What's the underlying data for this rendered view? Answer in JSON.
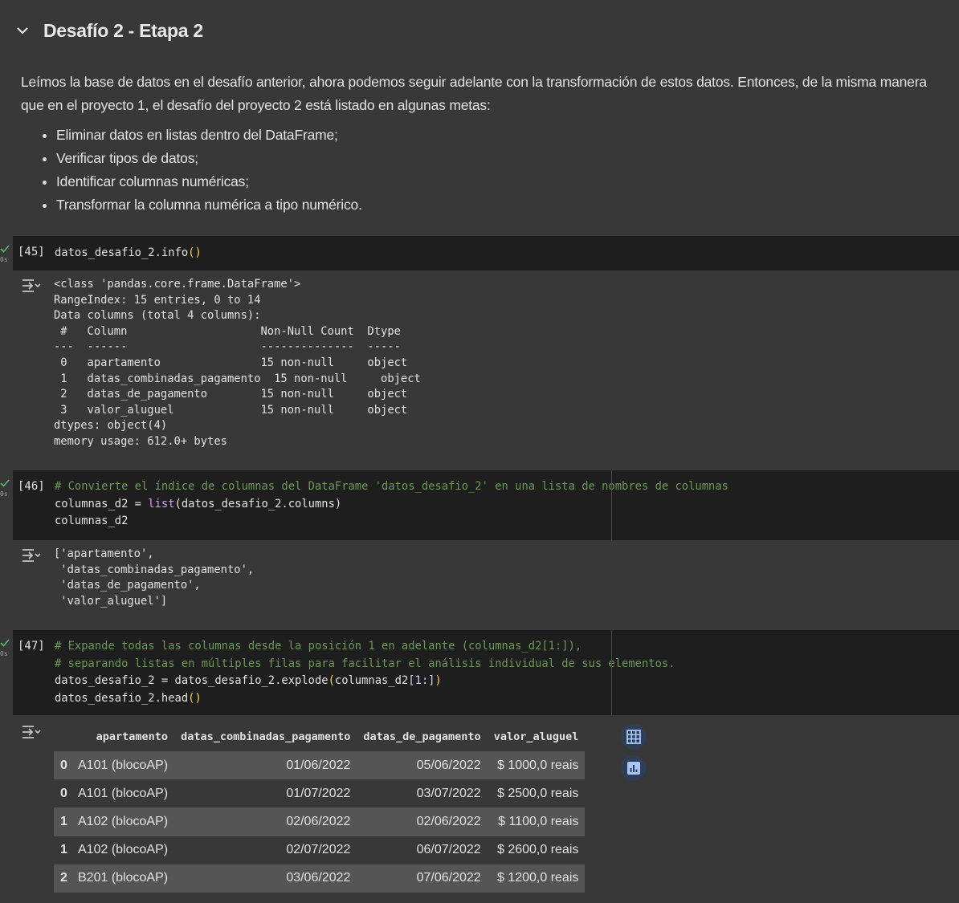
{
  "section": {
    "title": "Desafío 2 - Etapa 2",
    "intro": "Leímos la base de datos en el desafío anterior, ahora podemos seguir adelante con la transformación de estos datos. Entonces, de la misma manera que en el proyecto 1, el desafío del proyecto 2 está listado en algunas metas:",
    "goals": [
      "Eliminar datos en listas dentro del DataFrame;",
      "Verificar tipos de datos;",
      "Identificar columnas numéricas;",
      "Transformar la columna numérica a tipo numérico."
    ]
  },
  "cells": [
    {
      "count": "[45]",
      "exec_time": "0s",
      "code": {
        "l1_a": "datos_desafio_2.info",
        "l1_p": "()"
      },
      "output": [
        "<class 'pandas.core.frame.DataFrame'>",
        "RangeIndex: 15 entries, 0 to 14",
        "Data columns (total 4 columns):",
        " #   Column                    Non-Null Count  Dtype ",
        "---  ------                    --------------  ----- ",
        " 0   apartamento               15 non-null     object",
        " 1   datas_combinadas_pagamento  15 non-null     object",
        " 2   datas_de_pagamento        15 non-null     object",
        " 3   valor_aluguel             15 non-null     object",
        "dtypes: object(4)",
        "memory usage: 612.0+ bytes"
      ]
    },
    {
      "count": "[46]",
      "exec_time": "0s",
      "code": {
        "l1": "# Convierte el índice de columnas del DataFrame 'datos_desafio_2' en una lista de nombres de columnas",
        "l2_a": "columnas_d2 = ",
        "l2_b": "list",
        "l2_c": "(datos_desafio_2.columns)",
        "l3": "columnas_d2"
      },
      "output": [
        "['apartamento',",
        " 'datas_combinadas_pagamento',",
        " 'datas_de_pagamento',",
        " 'valor_aluguel']"
      ]
    },
    {
      "count": "[47]",
      "exec_time": "0s",
      "code": {
        "l1": "# Expande todas las columnas desde la posición 1 en adelante (columnas_d2[1:]),",
        "l2": "# separando listas en múltiples filas para facilitar el análisis individual de sus elementos.",
        "l3_a": "datos_desafio_2 = datos_desafio_2.explode",
        "l3_p1": "(",
        "l3_b": "columnas_d2",
        "l3_br": "[1:]",
        "l3_p2": ")",
        "l4_a": "datos_desafio_2.head",
        "l4_p": "()"
      }
    }
  ],
  "dataframe": {
    "columns": [
      "apartamento",
      "datas_combinadas_pagamento",
      "datas_de_pagamento",
      "valor_aluguel"
    ],
    "rows": [
      {
        "idx": "0",
        "apartamento": "A101 (blocoAP)",
        "combinadas": "01/06/2022",
        "pagamento": "05/06/2022",
        "valor": "$ 1000,0 reais"
      },
      {
        "idx": "0",
        "apartamento": "A101 (blocoAP)",
        "combinadas": "01/07/2022",
        "pagamento": "03/07/2022",
        "valor": "$ 2500,0 reais"
      },
      {
        "idx": "1",
        "apartamento": "A102 (blocoAP)",
        "combinadas": "02/06/2022",
        "pagamento": "02/06/2022",
        "valor": "$ 1100,0 reais"
      },
      {
        "idx": "1",
        "apartamento": "A102 (blocoAP)",
        "combinadas": "02/07/2022",
        "pagamento": "06/07/2022",
        "valor": "$ 2600,0 reais"
      },
      {
        "idx": "2",
        "apartamento": "B201 (blocoAP)",
        "combinadas": "03/06/2022",
        "pagamento": "07/06/2022",
        "valor": "$ 1200,0 reais"
      }
    ]
  },
  "icons": {
    "collapse": "chevron-down-icon",
    "run_status": "check-icon",
    "output_toggle": "output-collapse-icon",
    "table_view": "table-icon",
    "chart_suggest": "bar-chart-icon"
  },
  "colors": {
    "background": "#383838",
    "code_bg": "#1e1e1e",
    "comment": "#6a9955",
    "paren": "#f7d44c",
    "builtin": "#d4a0f0",
    "success": "#5bb974"
  }
}
